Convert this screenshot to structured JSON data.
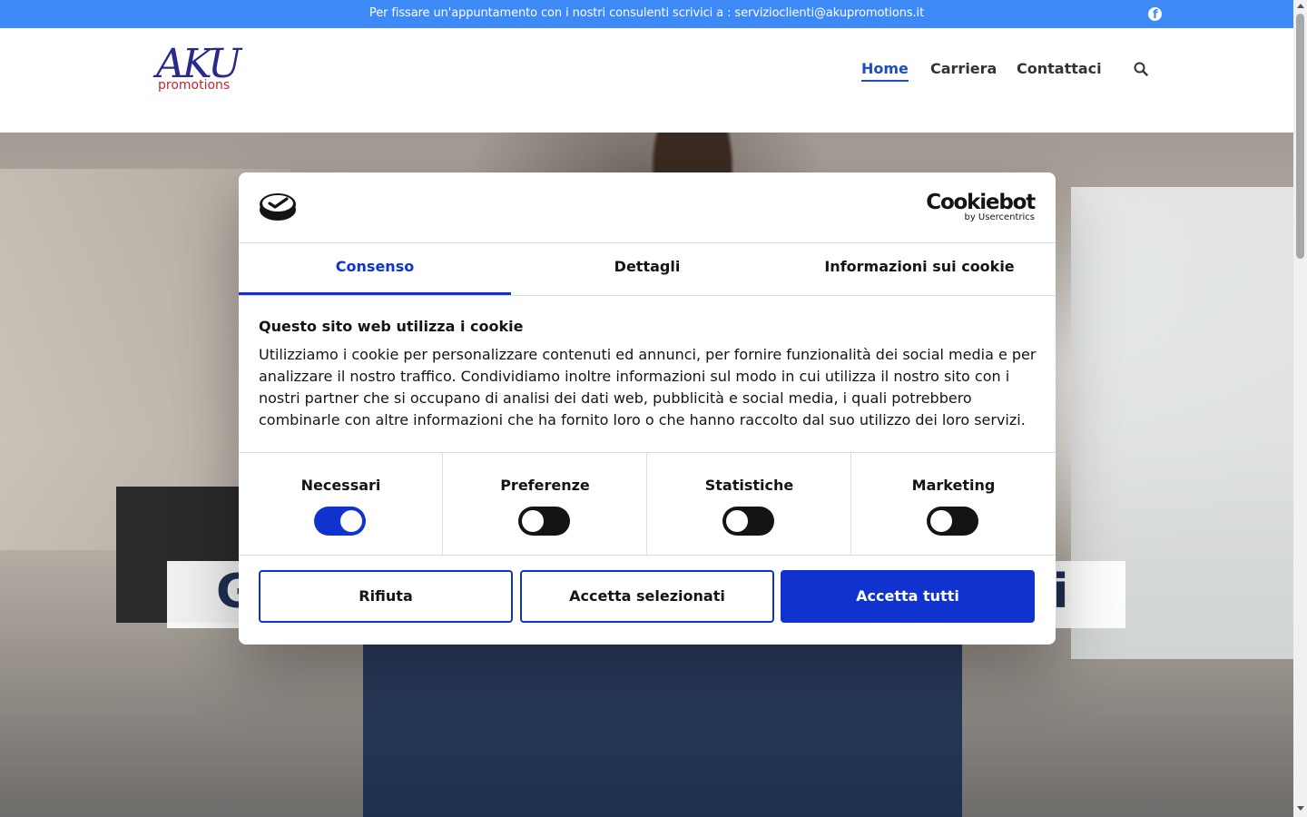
{
  "topbar": {
    "text": "Per fissare un'appuntamento con i nostri consulenti scrivici a : servizioclienti@akupromotions.it",
    "social_icon": "facebook-icon",
    "background": "#3d8af7"
  },
  "header": {
    "logo_main": "AKU",
    "logo_sub": "promotions",
    "nav": [
      {
        "label": "Home",
        "active": true
      },
      {
        "label": "Carriera",
        "active": false
      },
      {
        "label": "Contattaci",
        "active": false
      }
    ],
    "search_icon": "search-icon"
  },
  "hero": {
    "banner_left": "G",
    "banner_right": "ri"
  },
  "cookie_dialog": {
    "brand_name": "Cookiebot",
    "brand_by": "by Usercentrics",
    "tabs": [
      {
        "label": "Consenso",
        "active": true
      },
      {
        "label": "Dettagli",
        "active": false
      },
      {
        "label": "Informazioni sui cookie",
        "active": false
      }
    ],
    "title": "Questo sito web utilizza i cookie",
    "body": "Utilizziamo i cookie per personalizzare contenuti ed annunci, per fornire funzionalità dei social media e per analizzare il nostro traffico. Condividiamo inoltre informazioni sul modo in cui utilizza il nostro sito con i nostri partner che si occupano di analisi dei dati web, pubblicità e social media, i quali potrebbero combinarle con altre informazioni che ha fornito loro o che hanno raccolto dal suo utilizzo dei loro servizi.",
    "toggles": [
      {
        "label": "Necessari",
        "on": true
      },
      {
        "label": "Preferenze",
        "on": false
      },
      {
        "label": "Statistiche",
        "on": false
      },
      {
        "label": "Marketing",
        "on": false
      }
    ],
    "buttons": {
      "reject": "Rifiuta",
      "accept_selected": "Accetta selezionati",
      "accept_all": "Accetta tutti"
    },
    "accent_color": "#1032cf"
  }
}
